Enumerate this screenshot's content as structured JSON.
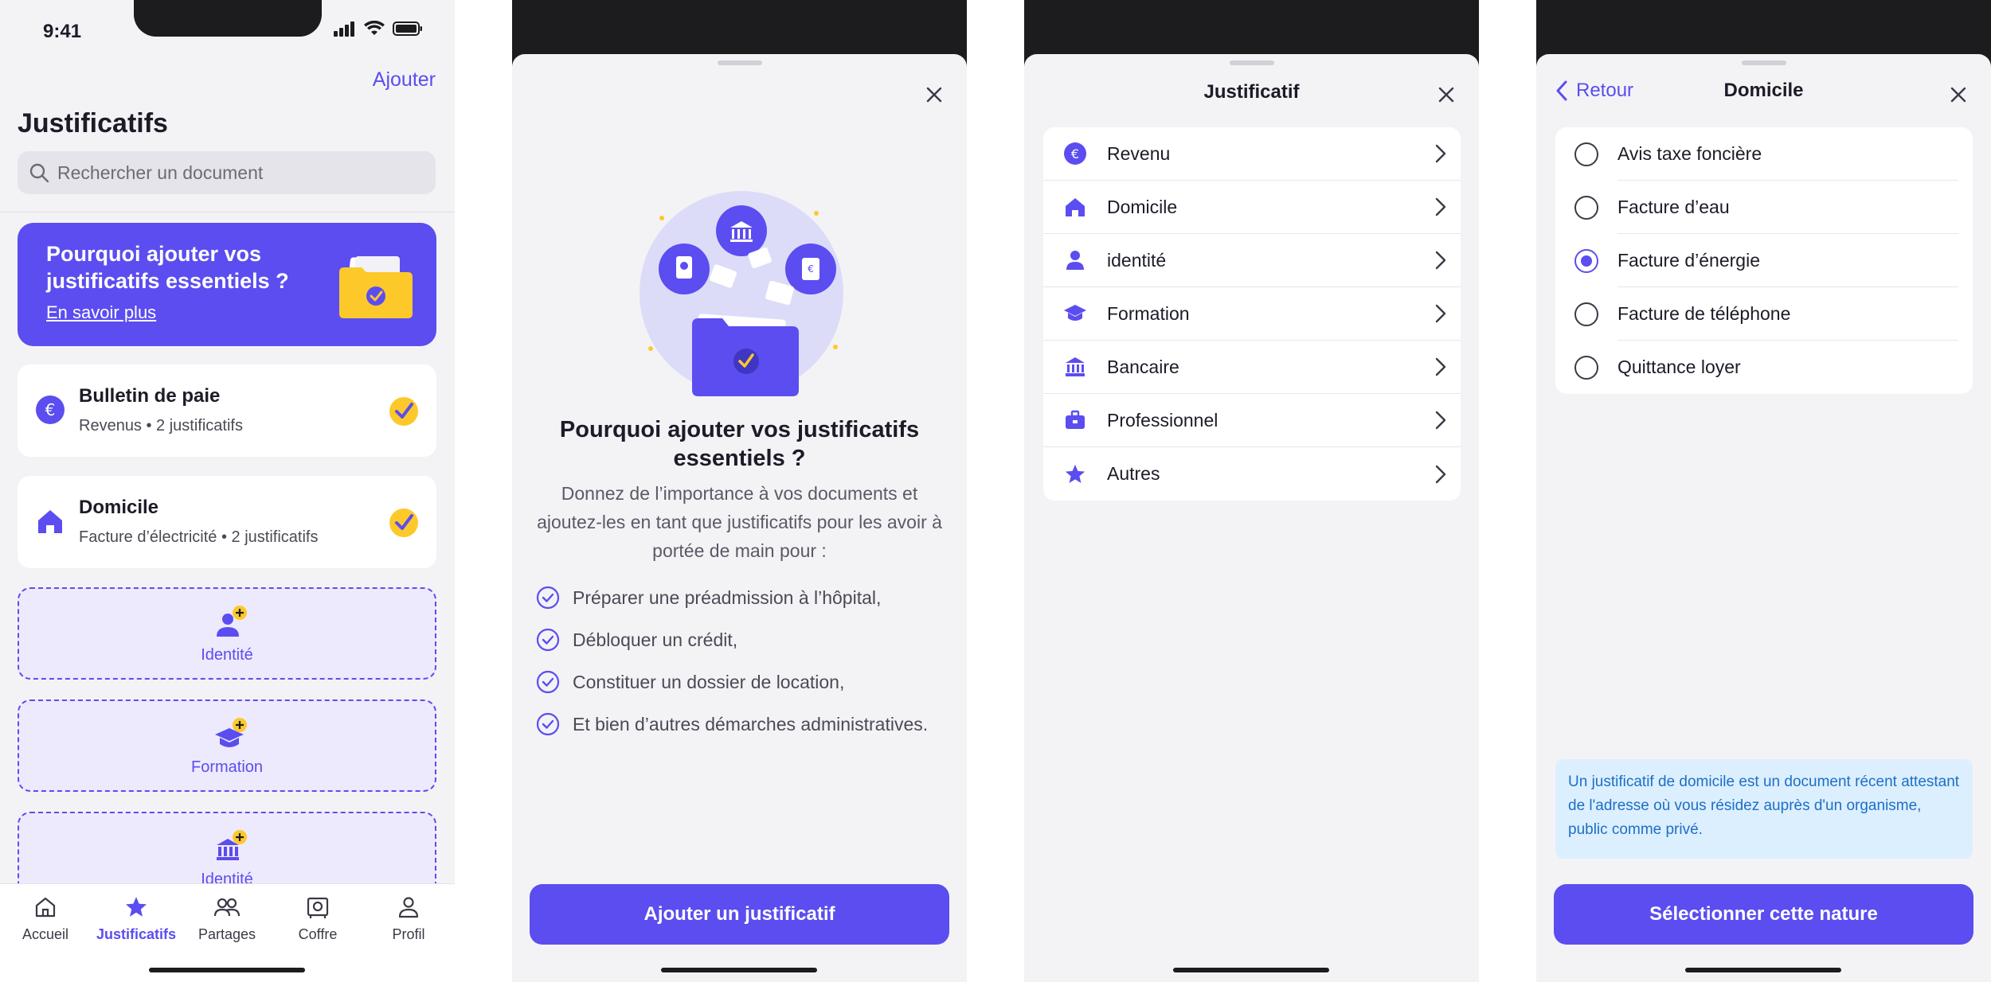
{
  "colors": {
    "accent": "#5b4df0",
    "check_yellow": "#fdc92a",
    "info_bg": "#dcefff",
    "info_text": "#1d6fc5"
  },
  "screen1": {
    "status_time": "9:41",
    "add_label": "Ajouter",
    "title": "Justificatifs",
    "search_placeholder": "Rechercher un document",
    "promo": {
      "title": "Pourquoi ajouter vos justificatifs essentiels ?",
      "link": "En savoir plus"
    },
    "cards": [
      {
        "title": "Bulletin de paie",
        "subtitle": "Revenus • 2 justificatifs",
        "icon": "euro-icon"
      },
      {
        "title": "Domicile",
        "subtitle": "Facture d’électricité • 2 justificatifs",
        "icon": "house-icon"
      }
    ],
    "add_slots": [
      {
        "label": "Identité",
        "icon": "person-plus-icon"
      },
      {
        "label": "Formation",
        "icon": "graduation-plus-icon"
      },
      {
        "label": "Identité",
        "icon": "bank-plus-icon"
      }
    ],
    "tabs": [
      {
        "label": "Accueil",
        "icon": "home-icon"
      },
      {
        "label": "Justificatifs",
        "icon": "star-icon",
        "active": true
      },
      {
        "label": "Partages",
        "icon": "people-icon"
      },
      {
        "label": "Coffre",
        "icon": "safe-icon"
      },
      {
        "label": "Profil",
        "icon": "profile-icon"
      }
    ]
  },
  "screen2": {
    "heading": "Pourquoi ajouter vos justificatifs essentiels ?",
    "body": "Donnez de l’importance à vos documents et ajoutez-les en tant que justificatifs pour les avoir à portée de main pour :",
    "bullets": [
      "Préparer une préadmission à l’hôpital,",
      "Débloquer un crédit,",
      "Constituer un dossier de location,",
      "Et bien d’autres démarches administratives."
    ],
    "button": "Ajouter un justificatif"
  },
  "screen3": {
    "title": "Justificatif",
    "items": [
      {
        "label": "Revenu",
        "icon": "euro-icon"
      },
      {
        "label": "Domicile",
        "icon": "house-icon"
      },
      {
        "label": "identité",
        "icon": "person-icon"
      },
      {
        "label": "Formation",
        "icon": "graduation-icon"
      },
      {
        "label": "Bancaire",
        "icon": "bank-icon"
      },
      {
        "label": "Professionnel",
        "icon": "briefcase-icon"
      },
      {
        "label": "Autres",
        "icon": "star-icon"
      }
    ]
  },
  "screen4": {
    "back": "Retour",
    "title": "Domicile",
    "options": [
      {
        "label": "Avis taxe foncière",
        "selected": false
      },
      {
        "label": "Facture d’eau",
        "selected": false
      },
      {
        "label": "Facture d’énergie",
        "selected": true
      },
      {
        "label": "Facture de téléphone",
        "selected": false
      },
      {
        "label": "Quittance loyer",
        "selected": false
      }
    ],
    "info": "Un justificatif de domicile est un document récent attestant de l'adresse où vous résidez auprès d'un organisme, public comme privé.",
    "button": "Sélectionner cette nature"
  }
}
